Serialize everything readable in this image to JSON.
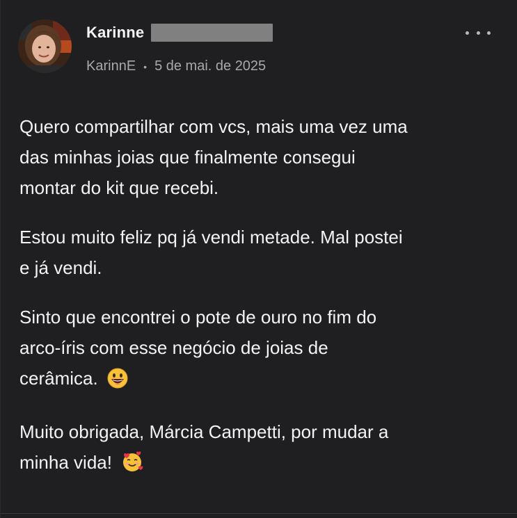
{
  "author": {
    "name": "Karinne",
    "handle": "KarinnE",
    "date": "5 de mai. de 2025",
    "separator": "•"
  },
  "menu": {
    "icon": "more-horizontal-icon"
  },
  "post": {
    "paragraphs": [
      {
        "line1": "Quero compartilhar com vcs, mais uma vez uma",
        "line2": "das minhas joias que finalmente consegui",
        "line3": "montar do kit que recebi."
      },
      {
        "line1": "Estou muito feliz pq já vendi metade. Mal postei",
        "line2": "e já vendi."
      },
      {
        "line1": "Sinto que encontrei o pote de ouro no fim do",
        "line2": "arco-íris com esse negócio de joias de",
        "line3": "cerâmica.",
        "emoji": "grinning-face-emoji"
      },
      {
        "line1": "Muito obrigada, Márcia Campetti, por mudar a",
        "line2": "minha vida!",
        "emoji": "smiling-face-with-hearts-emoji"
      }
    ]
  },
  "colors": {
    "background": "#1f1f22",
    "text": "#f3f3f3",
    "muted": "#a8a8ad",
    "redaction": "#808080"
  }
}
